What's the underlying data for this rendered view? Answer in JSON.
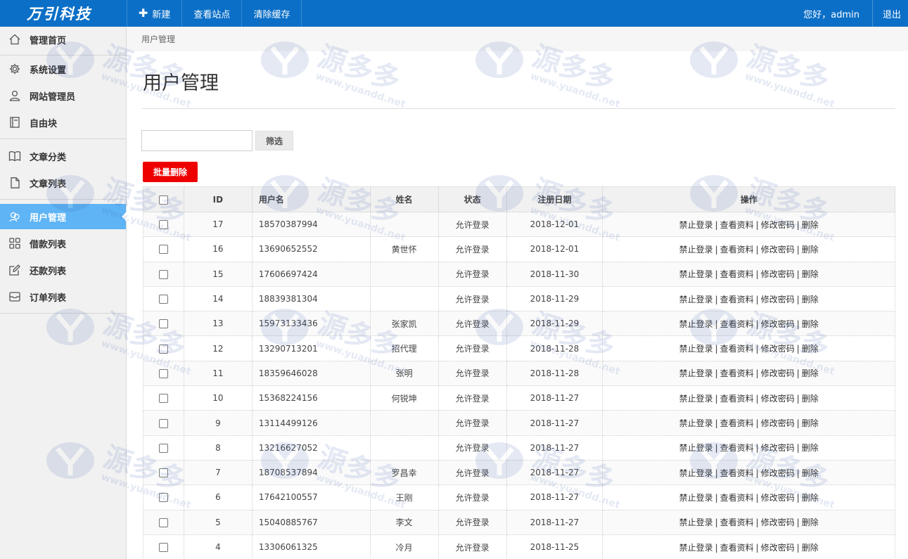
{
  "topbar": {
    "logo": "万引科技",
    "nav": [
      {
        "label": "新建",
        "icon": "plus-icon"
      },
      {
        "label": "查看站点"
      },
      {
        "label": "清除缓存"
      }
    ],
    "greeting": "您好，admin",
    "logout": "退出",
    "color": "#0b6fc7"
  },
  "sidebar": {
    "items": [
      {
        "label": "管理首页",
        "icon": "home-icon"
      },
      {
        "label": "系统设置",
        "icon": "gear-icon"
      },
      {
        "label": "网站管理员",
        "icon": "user-icon"
      },
      {
        "label": "自由块",
        "icon": "book-icon"
      },
      {
        "label": "文章分类",
        "icon": "open-book-icon"
      },
      {
        "label": "文章列表",
        "icon": "document-icon"
      },
      {
        "label": "用户管理",
        "icon": "users-icon",
        "active": true
      },
      {
        "label": "借款列表",
        "icon": "grid-icon"
      },
      {
        "label": "还款列表",
        "icon": "edit-icon"
      },
      {
        "label": "订单列表",
        "icon": "inbox-icon"
      }
    ],
    "active_color": "#5eb4f5"
  },
  "breadcrumb": "用户管理",
  "page_title": "用户管理",
  "filter": {
    "input_value": "",
    "button": "筛选"
  },
  "batch_delete": "批量删除",
  "table": {
    "headers": [
      "",
      "ID",
      "用户名",
      "姓名",
      "状态",
      "注册日期",
      "操作"
    ],
    "actions": [
      "禁止登录",
      "查看资料",
      "修改密码",
      "删除"
    ],
    "rows": [
      {
        "id": "17",
        "username": "18570387994",
        "name": "",
        "status": "允许登录",
        "date": "2018-12-01"
      },
      {
        "id": "16",
        "username": "13690652552",
        "name": "黄世怀",
        "status": "允许登录",
        "date": "2018-12-01"
      },
      {
        "id": "15",
        "username": "17606697424",
        "name": "",
        "status": "允许登录",
        "date": "2018-11-30"
      },
      {
        "id": "14",
        "username": "18839381304",
        "name": "",
        "status": "允许登录",
        "date": "2018-11-29"
      },
      {
        "id": "13",
        "username": "15973133436",
        "name": "张家凯",
        "status": "允许登录",
        "date": "2018-11-29"
      },
      {
        "id": "12",
        "username": "13290713201",
        "name": "招代理",
        "status": "允许登录",
        "date": "2018-11-28"
      },
      {
        "id": "11",
        "username": "18359646028",
        "name": "张明",
        "status": "允许登录",
        "date": "2018-11-28"
      },
      {
        "id": "10",
        "username": "15368224156",
        "name": "何锐坤",
        "status": "允许登录",
        "date": "2018-11-27"
      },
      {
        "id": "9",
        "username": "13114499126",
        "name": "",
        "status": "允许登录",
        "date": "2018-11-27"
      },
      {
        "id": "8",
        "username": "13216627052",
        "name": "",
        "status": "允许登录",
        "date": "2018-11-27"
      },
      {
        "id": "7",
        "username": "18708537894",
        "name": "罗昌幸",
        "status": "允许登录",
        "date": "2018-11-27"
      },
      {
        "id": "6",
        "username": "17642100557",
        "name": "王刚",
        "status": "允许登录",
        "date": "2018-11-27"
      },
      {
        "id": "5",
        "username": "15040885767",
        "name": "李文",
        "status": "允许登录",
        "date": "2018-11-27"
      },
      {
        "id": "4",
        "username": "13306061325",
        "name": "冷月",
        "status": "允许登录",
        "date": "2018-11-25"
      }
    ]
  },
  "watermark": {
    "text": "源多多",
    "url": "www.yuandd.net"
  }
}
